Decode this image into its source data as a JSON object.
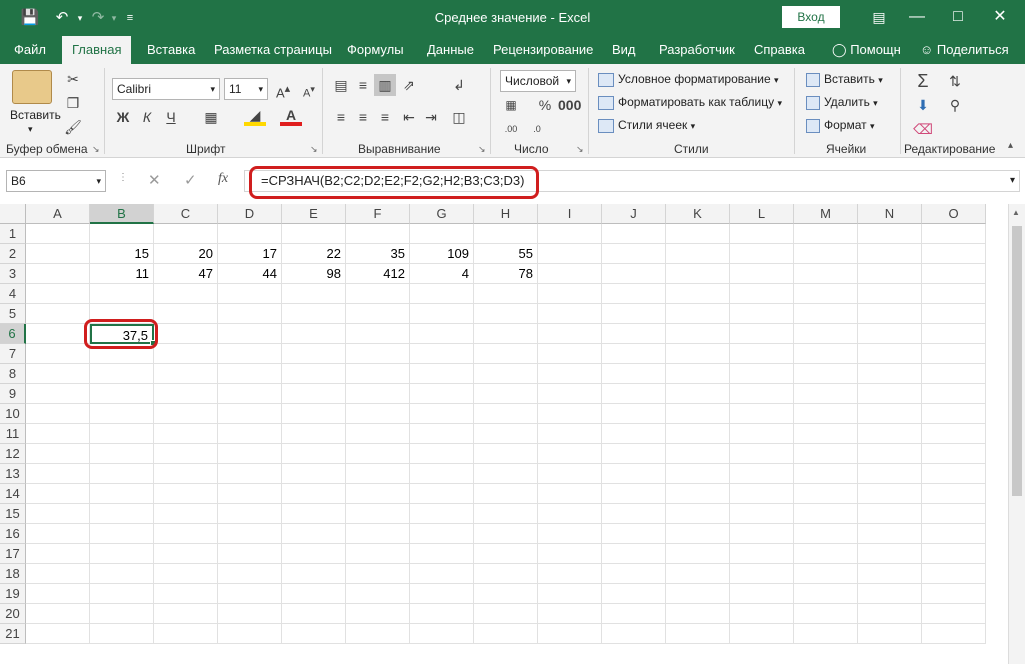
{
  "window": {
    "title": "Среднее значение  -  Excel",
    "signin": "Вход"
  },
  "tabs": [
    "Файл",
    "Главная",
    "Вставка",
    "Разметка страницы",
    "Формулы",
    "Данные",
    "Рецензирование",
    "Вид",
    "Разработчик",
    "Справка"
  ],
  "tell_me": "Помощн",
  "share": "Поделиться",
  "ribbon": {
    "clipboard": {
      "paste": "Вставить",
      "label": "Буфер обмена"
    },
    "font": {
      "name": "Calibri",
      "size": "11",
      "bold": "Ж",
      "italic": "К",
      "underline": "Ч",
      "label": "Шрифт"
    },
    "alignment": {
      "label": "Выравнивание"
    },
    "number": {
      "format": "Числовой",
      "label": "Число"
    },
    "styles": {
      "conditional": "Условное форматирование",
      "as_table": "Форматировать как таблицу",
      "cell_styles": "Стили ячеек",
      "label": "Стили"
    },
    "cells": {
      "insert": "Вставить",
      "delete": "Удалить",
      "format": "Формат",
      "label": "Ячейки"
    },
    "editing": {
      "label": "Редактирование"
    }
  },
  "formula_bar": {
    "name_box": "B6",
    "fx": "fx",
    "formula": "=СРЗНАЧ(B2;C2;D2;E2;F2;G2;H2;B3;C3;D3)"
  },
  "columns": [
    "A",
    "B",
    "C",
    "D",
    "E",
    "F",
    "G",
    "H",
    "I",
    "J",
    "K",
    "L",
    "M",
    "N",
    "O"
  ],
  "rows": [
    "1",
    "2",
    "3",
    "4",
    "5",
    "6",
    "7",
    "8",
    "9",
    "10",
    "11",
    "12",
    "13",
    "14",
    "15",
    "16",
    "17",
    "18",
    "19",
    "20",
    "21"
  ],
  "cells": {
    "B2": "15",
    "C2": "20",
    "D2": "17",
    "E2": "22",
    "F2": "35",
    "G2": "109",
    "H2": "55",
    "B3": "11",
    "C3": "47",
    "D3": "44",
    "E3": "98",
    "F3": "412",
    "G3": "4",
    "H3": "78",
    "B6": "37,5"
  },
  "colors": {
    "accent": "#217346",
    "highlight": "#d01e1e"
  }
}
